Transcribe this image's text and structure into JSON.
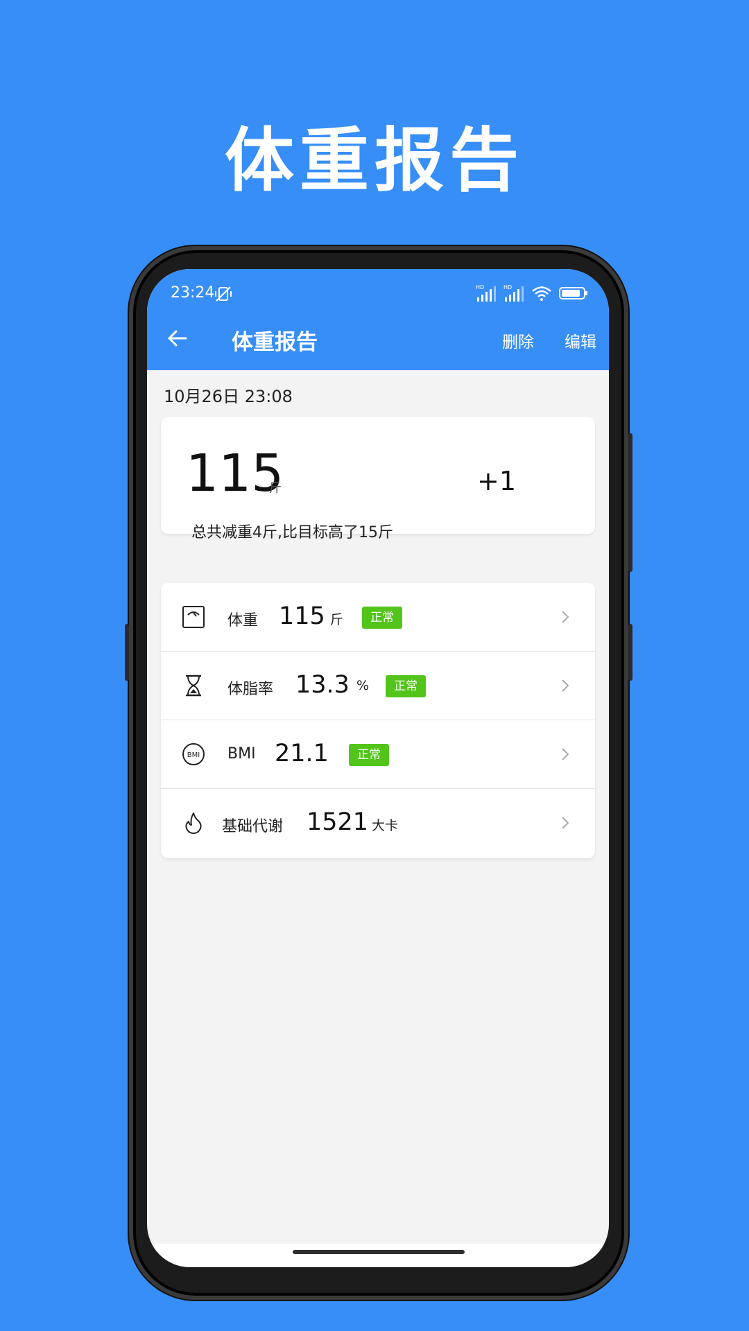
{
  "promo": {
    "title": "体重报告"
  },
  "status_bar": {
    "time": "23:24",
    "network_label": "HD"
  },
  "app_bar": {
    "title": "体重报告",
    "delete_label": "删除",
    "edit_label": "编辑"
  },
  "report": {
    "datetime": "10月26日 23:08",
    "weight": "115",
    "weight_unit": "斤",
    "delta": "+1",
    "summary": "总共减重4斤,比目标高了15斤"
  },
  "metrics": [
    {
      "icon": "scale-icon",
      "label": "体重",
      "value": "115",
      "unit": "斤",
      "status": "正常"
    },
    {
      "icon": "hourglass-icon",
      "label": "体脂率",
      "value": "13.3",
      "unit": "%",
      "status": "正常"
    },
    {
      "icon": "bmi-icon",
      "label": "BMI",
      "value": "21.1",
      "unit": "",
      "status": "正常"
    },
    {
      "icon": "flame-icon",
      "label": "基础代谢",
      "value": "1521",
      "unit": "大卡",
      "status": ""
    }
  ],
  "colors": {
    "primary": "#378ef7",
    "badge": "#52c41a",
    "background": "#f3f3f3"
  }
}
